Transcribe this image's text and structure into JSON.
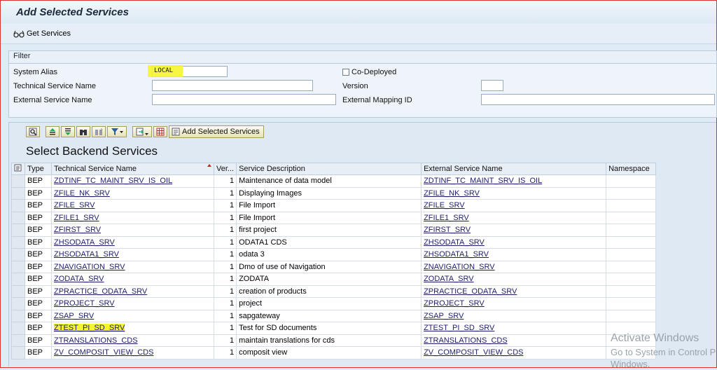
{
  "window": {
    "title": "Add Selected Services"
  },
  "toolbar": {
    "get_services_label": "Get Services"
  },
  "filter": {
    "header": "Filter",
    "system_alias_label": "System Alias",
    "system_alias_value": "LOCAL",
    "technical_service_name_label": "Technical Service Name",
    "technical_service_name_value": "",
    "external_service_name_label": "External Service Name",
    "external_service_name_value": "",
    "co_deployed_label": "Co-Deployed",
    "co_deployed_checked": false,
    "version_label": "Version",
    "version_value": "",
    "external_mapping_id_label": "External Mapping ID",
    "external_mapping_id_value": ""
  },
  "backend": {
    "add_selected_services_label": "Add Selected Services",
    "title": "Select Backend Services",
    "columns": {
      "type": "Type",
      "technical_service_name": "Technical Service Name",
      "version": "Ver...",
      "service_description": "Service Description",
      "external_service_name": "External Service Name",
      "namespace": "Namespace"
    },
    "rows": [
      {
        "type": "BEP",
        "tech": "ZDTINF_TC_MAINT_SRV_IS_OIL",
        "ver": "1",
        "desc": "Maintenance of data model",
        "ext": "ZDTINF_TC_MAINT_SRV_IS_OIL",
        "ns": ""
      },
      {
        "type": "BEP",
        "tech": "ZFILE_NK_SRV",
        "ver": "1",
        "desc": "Displaying Images",
        "ext": "ZFILE_NK_SRV",
        "ns": ""
      },
      {
        "type": "BEP",
        "tech": "ZFILE_SRV",
        "ver": "1",
        "desc": "File Import",
        "ext": "ZFILE_SRV",
        "ns": ""
      },
      {
        "type": "BEP",
        "tech": "ZFILE1_SRV",
        "ver": "1",
        "desc": "File Import",
        "ext": "ZFILE1_SRV",
        "ns": ""
      },
      {
        "type": "BEP",
        "tech": "ZFIRST_SRV",
        "ver": "1",
        "desc": "first project",
        "ext": "ZFIRST_SRV",
        "ns": ""
      },
      {
        "type": "BEP",
        "tech": "ZHSODATA_SRV",
        "ver": "1",
        "desc": "ODATA1 CDS",
        "ext": "ZHSODATA_SRV",
        "ns": ""
      },
      {
        "type": "BEP",
        "tech": "ZHSODATA1_SRV",
        "ver": "1",
        "desc": "odata 3",
        "ext": "ZHSODATA1_SRV",
        "ns": ""
      },
      {
        "type": "BEP",
        "tech": "ZNAVIGATION_SRV",
        "ver": "1",
        "desc": "Dmo of use of Navigation",
        "ext": "ZNAVIGATION_SRV",
        "ns": ""
      },
      {
        "type": "BEP",
        "tech": "ZODATA_SRV",
        "ver": "1",
        "desc": "ZODATA",
        "ext": "ZODATA_SRV",
        "ns": ""
      },
      {
        "type": "BEP",
        "tech": "ZPRACTICE_ODATA_SRV",
        "ver": "1",
        "desc": "creation of products",
        "ext": "ZPRACTICE_ODATA_SRV",
        "ns": ""
      },
      {
        "type": "BEP",
        "tech": "ZPROJECT_SRV",
        "ver": "1",
        "desc": "project",
        "ext": "ZPROJECT_SRV",
        "ns": ""
      },
      {
        "type": "BEP",
        "tech": "ZSAP_SRV",
        "ver": "1",
        "desc": "sapgateway",
        "ext": "ZSAP_SRV",
        "ns": ""
      },
      {
        "type": "BEP",
        "tech": "ZTEST_PI_SD_SRV",
        "ver": "1",
        "desc": "Test for SD documents",
        "ext": "ZTEST_PI_SD_SRV",
        "ns": "",
        "highlight": true
      },
      {
        "type": "BEP",
        "tech": "ZTRANSLATIONS_CDS",
        "ver": "1",
        "desc": "maintain translations for cds",
        "ext": "ZTRANSLATIONS_CDS",
        "ns": ""
      },
      {
        "type": "BEP",
        "tech": "ZV_COMPOSIT_VIEW_CDS",
        "ver": "1",
        "desc": "composit view",
        "ext": "ZV_COMPOSIT_VIEW_CDS",
        "ns": ""
      }
    ]
  },
  "watermark": {
    "line1": "Activate Windows",
    "line2": "Go to System in Control P",
    "line3": "Windows."
  },
  "colors": {
    "highlight": "#f5f52f",
    "accent_border": "#dd3333",
    "link": "#1d1d6c"
  }
}
